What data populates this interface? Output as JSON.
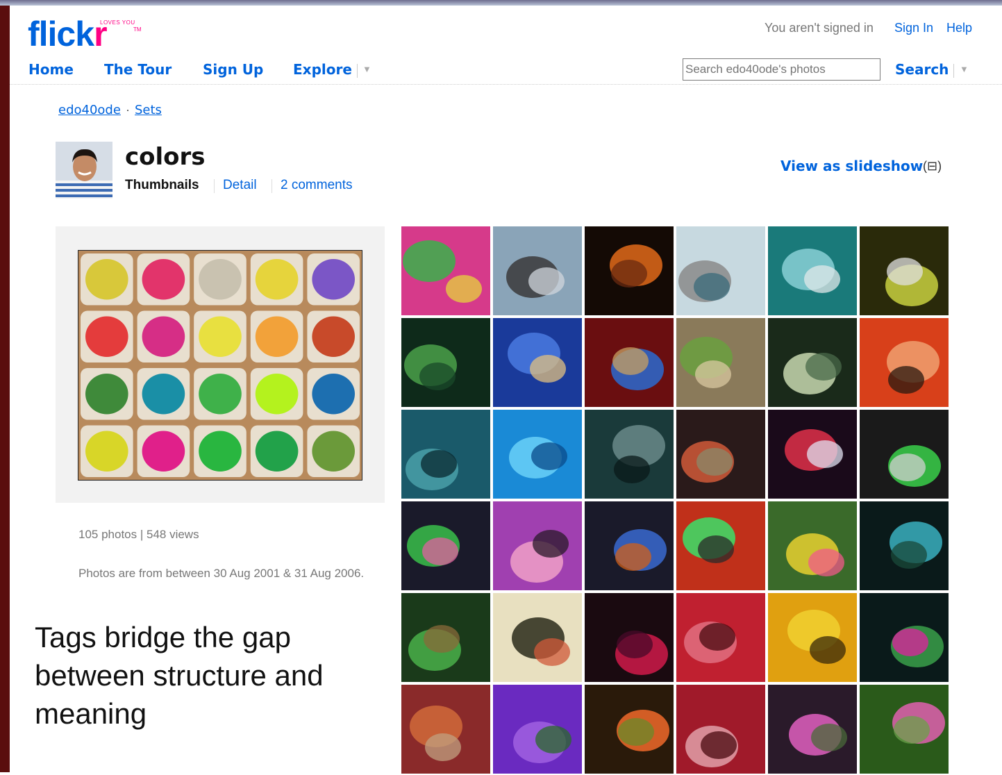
{
  "header": {
    "logo_main": "flick",
    "logo_accent": "r",
    "logo_tagline": "LOVES YOU",
    "logo_tm": "TM",
    "signed_status": "You aren't signed in",
    "sign_in": "Sign In",
    "help": "Help"
  },
  "nav": {
    "items": [
      {
        "label": "Home"
      },
      {
        "label": "The Tour"
      },
      {
        "label": "Sign Up"
      },
      {
        "label": "Explore"
      }
    ],
    "search_placeholder": "Search edo40ode's photos",
    "search_button": "Search"
  },
  "breadcrumb": {
    "user": "edo40ode",
    "separator": "·",
    "section": "Sets"
  },
  "set": {
    "title": "colors",
    "tabs": [
      "Thumbnails",
      "Detail",
      "2 comments"
    ],
    "slideshow": "View as slideshow",
    "slideshow_icon": "(⊟)",
    "stats": "105 photos | 548 views",
    "dates": "Photos are from between 30 Aug 2001 & 31 Aug 2006."
  },
  "caption": "Tags bridge the gap between structure and meaning",
  "colors": {
    "link_blue": "#0063dc",
    "flickr_pink": "#ff0084"
  },
  "thumbnails": [
    {
      "icon": "spice-market"
    },
    {
      "icon": "street-cables"
    },
    {
      "icon": "bonfire-night"
    },
    {
      "icon": "airport-jetbridge"
    },
    {
      "icon": "jetski-sea"
    },
    {
      "icon": "flower-macro"
    },
    {
      "icon": "green-hose"
    },
    {
      "icon": "pool-toy"
    },
    {
      "icon": "paint-brush"
    },
    {
      "icon": "grasshopper"
    },
    {
      "icon": "leaf-macro"
    },
    {
      "icon": "red-building"
    },
    {
      "icon": "agave"
    },
    {
      "icon": "blue-tubes"
    },
    {
      "icon": "keyboard"
    },
    {
      "icon": "glass-sunset"
    },
    {
      "icon": "neon-lights"
    },
    {
      "icon": "robot-toy"
    },
    {
      "icon": "alien-toy"
    },
    {
      "icon": "pink-panther-toy"
    },
    {
      "icon": "blue-robot-toy"
    },
    {
      "icon": "skateboard-toy"
    },
    {
      "icon": "fish-toys"
    },
    {
      "icon": "mixing-desk"
    },
    {
      "icon": "green-window"
    },
    {
      "icon": "butterfly"
    },
    {
      "icon": "red-blur"
    },
    {
      "icon": "red-glass"
    },
    {
      "icon": "yellow-lilies"
    },
    {
      "icon": "scaffolding"
    },
    {
      "icon": "autumn-leaves"
    },
    {
      "icon": "purple-flowers"
    },
    {
      "icon": "orange-flowers"
    },
    {
      "icon": "red-crystal"
    },
    {
      "icon": "pink-flower"
    },
    {
      "icon": "daisies"
    }
  ]
}
